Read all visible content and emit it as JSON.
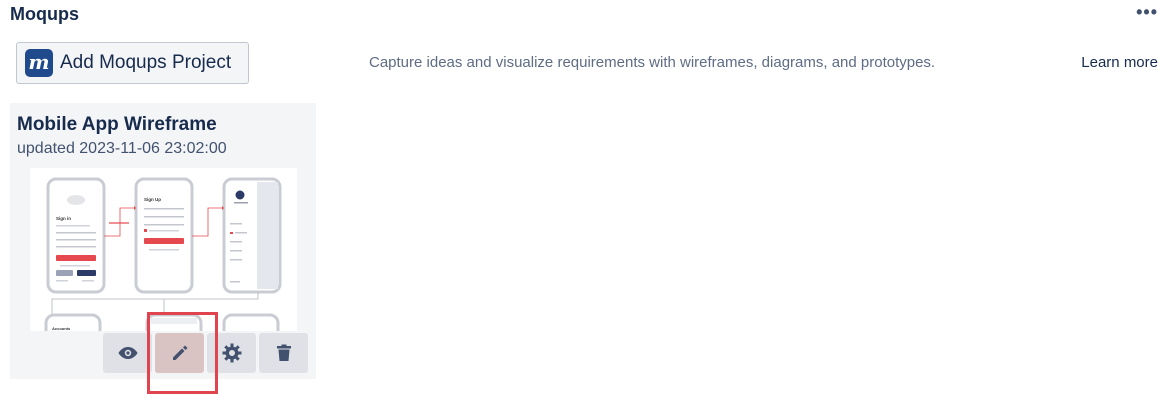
{
  "header": {
    "title": "Moqups",
    "more_label": "•••"
  },
  "add_project": {
    "logo_letter": "m",
    "label": "Add Moqups Project"
  },
  "description": "Capture ideas and visualize requirements with wireframes, diagrams, and prototypes.",
  "learn_more": "Learn more",
  "project_card": {
    "title": "Mobile App Wireframe",
    "updated": "updated 2023-11-06 23:02:00",
    "thumbnail": {
      "screen_1_title": "Sign in",
      "screen_2_title": "Sign Up",
      "screen_4_title": "Accounts"
    },
    "actions": [
      {
        "name": "view",
        "icon": "eye-icon"
      },
      {
        "name": "edit",
        "icon": "pencil-icon",
        "highlighted": true
      },
      {
        "name": "settings",
        "icon": "gear-icon"
      },
      {
        "name": "delete",
        "icon": "trash-icon"
      }
    ]
  },
  "colors": {
    "brand": "#1f4a8c",
    "text_primary": "#172b4d",
    "text_secondary": "#5e6c84",
    "card_bg": "#f4f5f7",
    "button_bg": "#dfe1e6",
    "highlight": "#e0444f",
    "wireframe_accent": "#e5484d"
  }
}
